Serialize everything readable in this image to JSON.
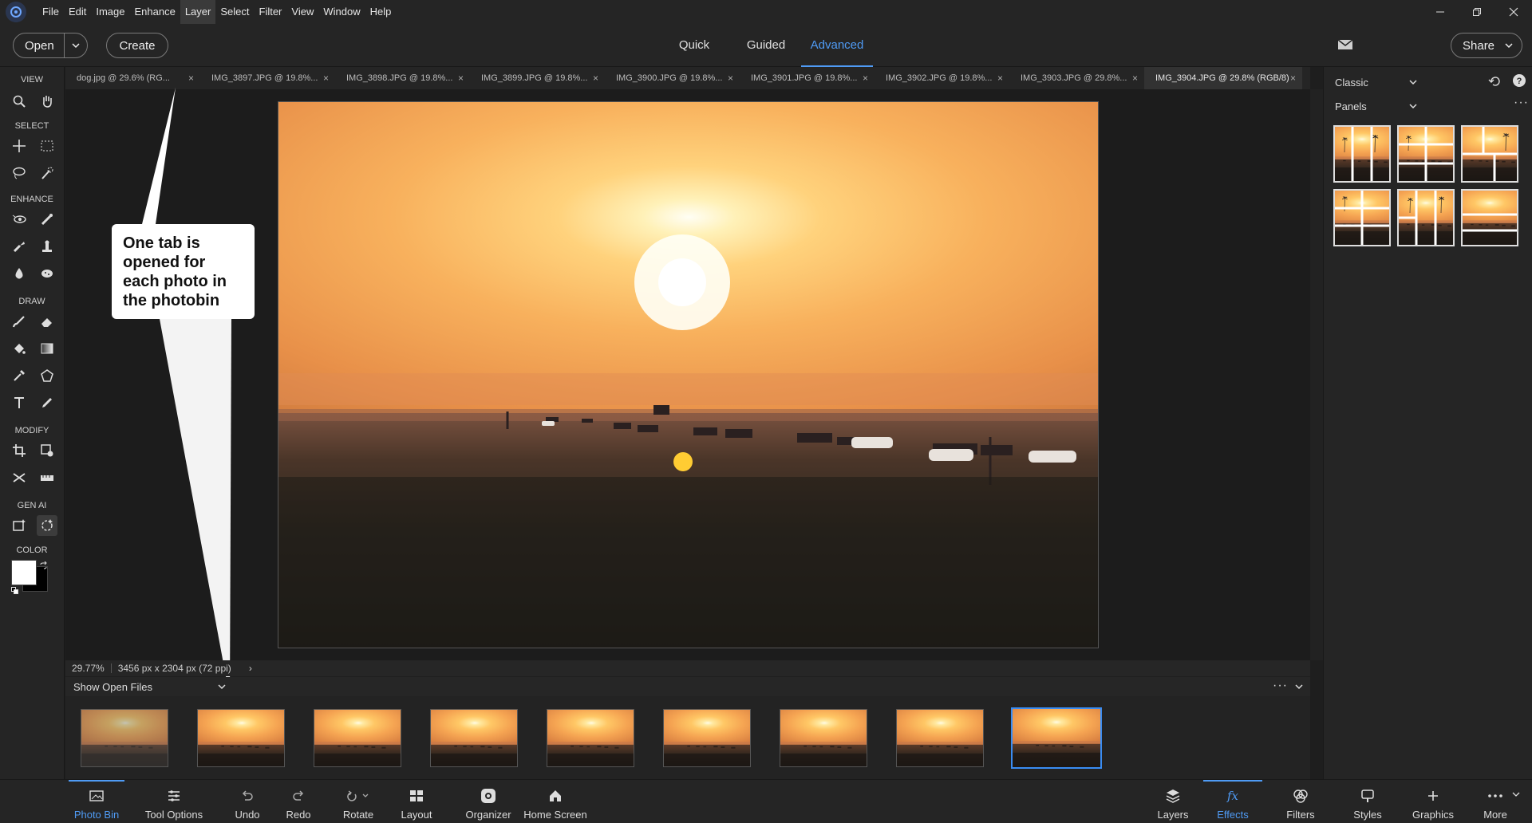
{
  "menubar": {
    "items": [
      "File",
      "Edit",
      "Image",
      "Enhance",
      "Layer",
      "Select",
      "Filter",
      "View",
      "Window",
      "Help"
    ]
  },
  "modebar": {
    "open_label": "Open",
    "create_label": "Create",
    "tabs": [
      "Quick",
      "Guided",
      "Advanced"
    ],
    "active_tab": "Advanced",
    "share_label": "Share"
  },
  "toolbox": {
    "sections": [
      "VIEW",
      "SELECT",
      "ENHANCE",
      "DRAW",
      "MODIFY",
      "GEN AI",
      "COLOR"
    ]
  },
  "doc_tabs": [
    "dog.jpg @ 29.6% (RG...",
    "IMG_3897.JPG @ 19.8%...",
    "IMG_3898.JPG @ 19.8%...",
    "IMG_3899.JPG @ 19.8%...",
    "IMG_3900.JPG @ 19.8%...",
    "IMG_3901.JPG @ 19.8%...",
    "IMG_3902.JPG @ 19.8%...",
    "IMG_3903.JPG @ 29.8%...",
    "IMG_3904.JPG @ 29.8% (RGB/8)"
  ],
  "callout": {
    "text": "One tab is opened for each photo in the photobin"
  },
  "status": {
    "zoom": "29.77%",
    "dimensions": "3456 px x 2304 px (72 ppi)"
  },
  "photobin": {
    "dropdown_label": "Show Open Files",
    "thumbnail_count": 9,
    "selected_index": 8
  },
  "rightpanel": {
    "mode_label": "Classic",
    "category_label": "Panels"
  },
  "taskbar": {
    "left": [
      "Photo Bin",
      "Tool Options",
      "Undo",
      "Redo",
      "Rotate",
      "Layout",
      "Organizer",
      "Home Screen"
    ],
    "right": [
      "Layers",
      "Effects",
      "Filters",
      "Styles",
      "Graphics",
      "More"
    ],
    "active_left": "Photo Bin",
    "active_right": "Effects"
  },
  "colors": {
    "accent": "#4f9bf5",
    "foreground_swatch": "#ffffff",
    "background_swatch": "#000000"
  }
}
